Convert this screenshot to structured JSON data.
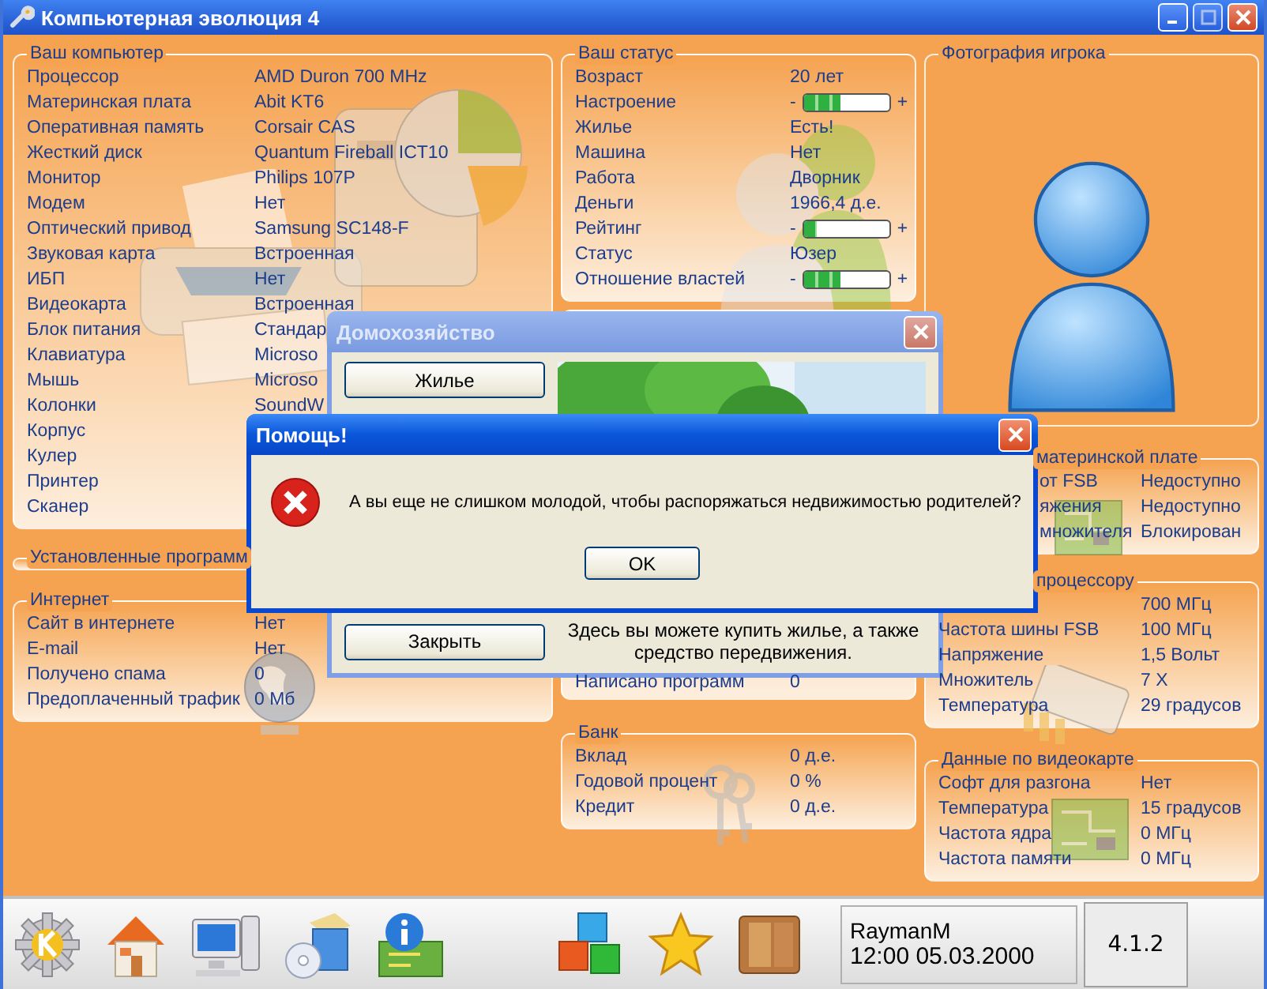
{
  "window": {
    "title": "Компьютерная эволюция 4"
  },
  "computer": {
    "title": "Ваш компьютер",
    "rows": [
      {
        "label": "Процессор",
        "value": "AMD Duron 700 MHz"
      },
      {
        "label": "Материнская плата",
        "value": "Abit KT6"
      },
      {
        "label": "Оперативная память",
        "value": "Corsair CAS"
      },
      {
        "label": "Жесткий диск",
        "value": "Quantum Fireball ICT10"
      },
      {
        "label": "Монитор",
        "value": "Philips 107P"
      },
      {
        "label": "Модем",
        "value": "Нет"
      },
      {
        "label": "Оптический привод",
        "value": "Samsung SC148-F"
      },
      {
        "label": "Звуковая карта",
        "value": "Встроенная"
      },
      {
        "label": "ИБП",
        "value": "Нет"
      },
      {
        "label": "Видеокарта",
        "value": "Встроенная"
      },
      {
        "label": "Блок питания",
        "value": "Стандар"
      },
      {
        "label": "Клавиатура",
        "value": "Microso"
      },
      {
        "label": "Мышь",
        "value": "Microso"
      },
      {
        "label": "Колонки",
        "value": "SoundW"
      },
      {
        "label": "Корпус"
      },
      {
        "label": "Кулер"
      },
      {
        "label": "Принтер"
      },
      {
        "label": "Сканер"
      }
    ]
  },
  "programs": {
    "title": "Установленные программ"
  },
  "internet": {
    "title": "Интернет",
    "rows": [
      {
        "label": "Сайт в интернете",
        "value": "Нет"
      },
      {
        "label": "E-mail",
        "value": "Нет"
      },
      {
        "label": "Получено спама",
        "value": "0"
      },
      {
        "label": "Предоплаченный трафик",
        "value": "0 Мб"
      }
    ]
  },
  "status": {
    "title": "Ваш статус",
    "rows": [
      {
        "kind": "text",
        "label": "Возраст",
        "value": "20 лет"
      },
      {
        "kind": "bar",
        "label": "Настроение",
        "minus": "-",
        "plus": "+",
        "level": 0.42
      },
      {
        "kind": "text",
        "label": "Жилье",
        "value": "Есть!"
      },
      {
        "kind": "text",
        "label": "Машина",
        "value": "Нет"
      },
      {
        "kind": "text",
        "label": "Работа",
        "value": "Дворник"
      },
      {
        "kind": "text",
        "label": "Деньги",
        "value": "1966,4 д.е."
      },
      {
        "kind": "bar",
        "label": "Рейтинг",
        "minus": "-",
        "plus": "+",
        "level": 0.15
      },
      {
        "kind": "text",
        "label": "Статус",
        "value": "Юзер"
      },
      {
        "kind": "bar",
        "label": "Отношение властей",
        "minus": "-",
        "plus": "+",
        "level": 0.42
      }
    ]
  },
  "programming": {
    "rows": [
      {
        "label": "Написано программ",
        "value": "0"
      }
    ]
  },
  "bank": {
    "title": "Банк",
    "rows": [
      {
        "label": "Вклад",
        "value": "0 д.е."
      },
      {
        "label": "Годовой процент",
        "value": "0 %"
      },
      {
        "label": "Кредит",
        "value": "0 д.е."
      }
    ]
  },
  "photo": {
    "title": "Фотография игрока"
  },
  "motherboard": {
    "title": "материнской плате",
    "rows": [
      {
        "label": "от FSB",
        "value": "Недоступно"
      },
      {
        "label": "яжения",
        "value": "Недоступно"
      },
      {
        "label": "множителя",
        "value": "Блокирован"
      }
    ]
  },
  "processor": {
    "title": "процессору",
    "rows": [
      {
        "value": "700 МГц"
      },
      {
        "label": "Частота шины FSB",
        "value": "100 МГц"
      },
      {
        "label": "Напряжение",
        "value": "1,5 Вольт"
      },
      {
        "label": "Множитель",
        "value": "7 X"
      },
      {
        "label": "Температура",
        "value": "29 градусов"
      }
    ]
  },
  "video": {
    "title": "Данные по видеокарте",
    "rows": [
      {
        "label": "Софт для разгона",
        "value": "Нет"
      },
      {
        "label": "Температура",
        "value": "15 градусов"
      },
      {
        "label": "Частота ядра",
        "value": "0 МГц"
      },
      {
        "label": "Частота памяти",
        "value": "0 МГц"
      }
    ]
  },
  "housing_dialog": {
    "title": "Домохозяйство",
    "top_button": "Жилье",
    "close_button": "Закрыть",
    "description": "Здесь вы можете купить жилье, а также средство передвижения."
  },
  "help_dialog": {
    "title": "Помощь!",
    "message": "А вы еще не слишком молодой, чтобы распоряжаться недвижимостью родителей?",
    "button": "OK"
  },
  "taskbar": {
    "user": "RaymanM",
    "datetime": "12:00 05.03.2000",
    "version": "4.1.2"
  }
}
